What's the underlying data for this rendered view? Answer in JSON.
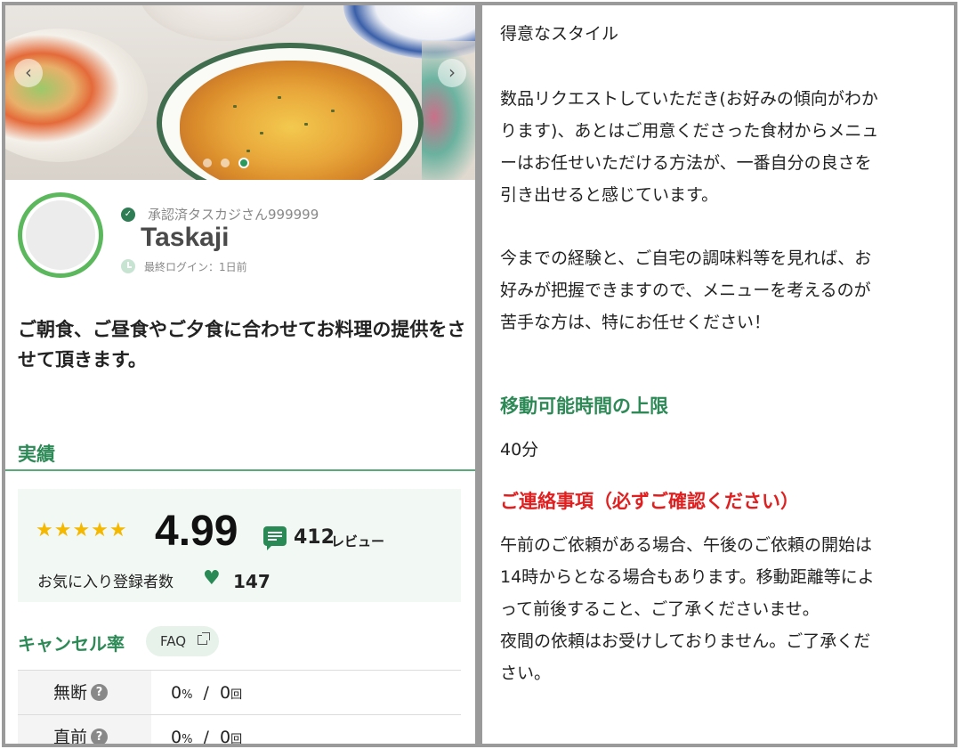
{
  "hero": {
    "prev_icon": "chevron-left-icon",
    "next_icon": "chevron-right-icon",
    "slide_count": 3,
    "active_slide": 2
  },
  "profile": {
    "verified_label": "承認済タスカジさん999999",
    "name": "Taskaji",
    "last_login": "最終ログイン：1日前"
  },
  "headline": "ご朝食、ご昼食やご夕食に合わせてお料理の提供をさせて頂きます。",
  "results": {
    "section_title": "実績",
    "star_count": 5,
    "rating": "4.99",
    "review_count": "412",
    "review_label": "レビュー",
    "favorites_label": "お気に入り登録者数",
    "favorites_count": "147"
  },
  "cancel": {
    "title": "キャンセル率",
    "faq_label": "FAQ",
    "rows": [
      {
        "label": "無断",
        "percent": "0",
        "percent_unit": "%",
        "sep": "/",
        "count": "0",
        "count_unit": "回"
      },
      {
        "label": "直前",
        "percent": "0",
        "percent_unit": "%",
        "sep": "/",
        "count": "0",
        "count_unit": "回"
      }
    ]
  },
  "right": {
    "style_title": "得意なスタイル",
    "style_lines_1": [
      "数品リクエストしていただき(お好みの傾向がわか",
      "ります)、あとはご用意くださった食材からメニュ",
      "ーはお任せいただける方法が、一番自分の良さを",
      "引き出せると感じています。"
    ],
    "style_lines_2": [
      "今までの経験と、ご自宅の調味料等を見れば、お",
      "好みが把握できますので、メニューを考えるのが",
      "苦手な方は、特にお任せください！"
    ],
    "travel_title": "移動可能時間の上限",
    "travel_value": "40分",
    "notice_title": "ご連絡事項（必ずご確認ください）",
    "notice_lines": [
      "午前のご依頼がある場合、午後のご依頼の開始は",
      "14時からとなる場合もあります。移動距離等によ",
      "って前後すること、ご了承くださいませ。",
      "夜間の依頼はお受けしておりません。ご了承くだ",
      "さい。"
    ]
  },
  "colors": {
    "accent_green": "#2d8a57",
    "notice_red": "#e02020",
    "star": "#f5b800"
  }
}
